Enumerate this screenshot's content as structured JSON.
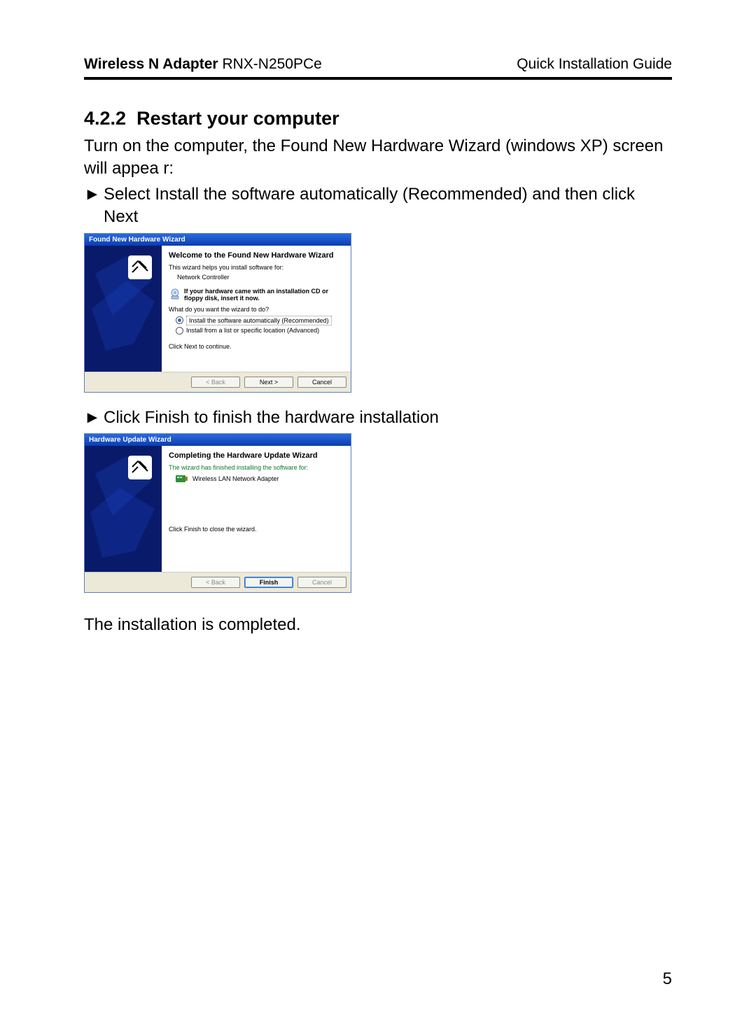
{
  "header": {
    "product_bold": "Wireless N Adapter",
    "product_model": "RNX-N250PCe",
    "doc_type": "Quick Installation Guide"
  },
  "section": {
    "number": "4.2.2",
    "title": "Restart your computer"
  },
  "para1": "Turn on the computer, the Found New Hardware Wizard (windows XP) screen will appea r:",
  "bullet1": "Select Install the software automatically (Recommended) and then click Next",
  "wiz1": {
    "titlebar": "Found New Hardware Wizard",
    "heading": "Welcome to the Found New Hardware Wizard",
    "intro": "This wizard helps you install software for:",
    "device": "Network Controller",
    "cd_note": "If your hardware came with an installation CD or floppy disk, insert it now.",
    "question": "What do you want the wizard to do?",
    "opt1": "Install the software automatically (Recommended)",
    "opt2": "Install from a list or specific location (Advanced)",
    "continue": "Click Next to continue.",
    "btn_back": "< Back",
    "btn_next": "Next >",
    "btn_cancel": "Cancel"
  },
  "bullet2": "Click Finish to finish the hardware installation",
  "wiz2": {
    "titlebar": "Hardware Update Wizard",
    "heading": "Completing the Hardware Update Wizard",
    "done": "The wizard has finished installing the software for:",
    "device": "Wireless LAN Network Adapter",
    "close": "Click Finish to close the wizard.",
    "btn_back": "< Back",
    "btn_finish": "Finish",
    "btn_cancel": "Cancel"
  },
  "para2": "The installation is completed.",
  "page_number": "5",
  "glyphs": {
    "arrow": "►"
  }
}
